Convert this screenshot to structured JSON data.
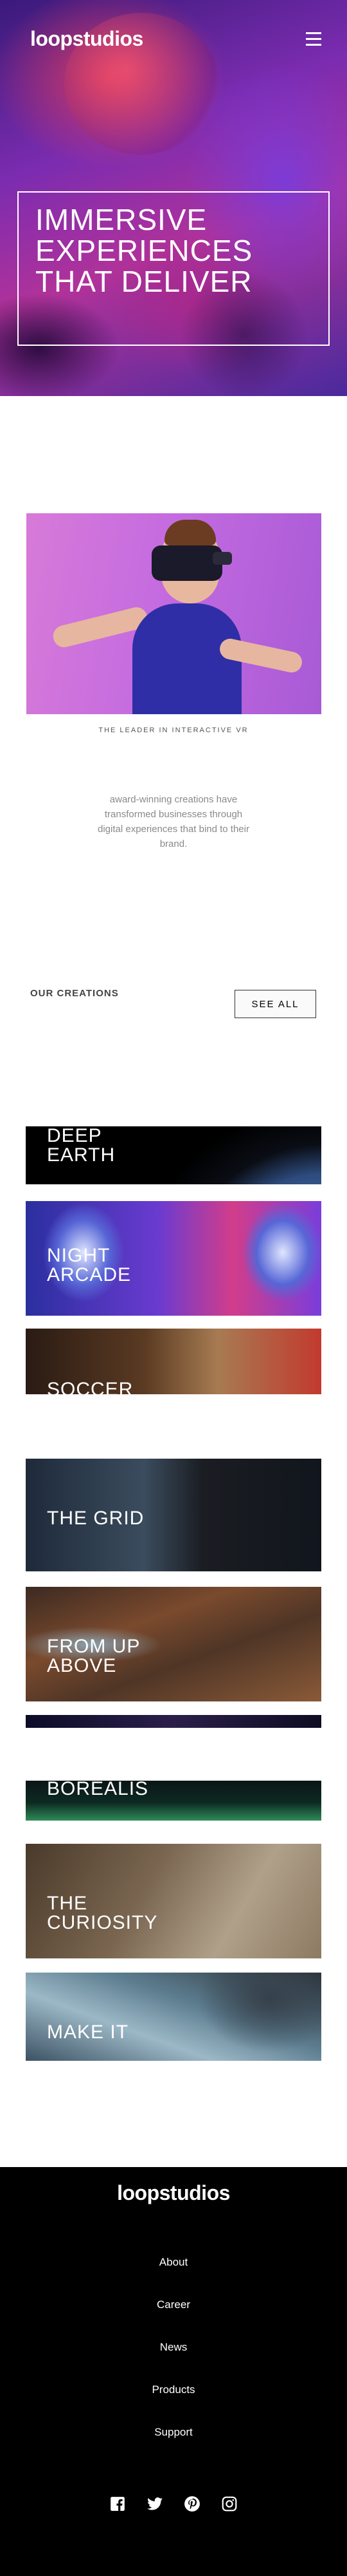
{
  "header": {
    "logo": "loopstudios",
    "menu_icon": "hamburger-icon"
  },
  "hero": {
    "title": "Immersive experiences that deliver"
  },
  "intro": {
    "title": "THE LEADER IN INTERACTIVE VR",
    "text": "award-winning creations have transformed businesses through digital experiences that bind to their brand."
  },
  "creations": {
    "heading": "OUR CREATIONS",
    "see_all": "SEE ALL",
    "items": [
      {
        "title": "Deep earth"
      },
      {
        "title": "Night arcade"
      },
      {
        "title": "Soccer"
      },
      {
        "title": "The grid"
      },
      {
        "title": "From up above"
      },
      {
        "title": "Borealis"
      },
      {
        "title": "The curiosity"
      },
      {
        "title": "Make it"
      }
    ]
  },
  "footer": {
    "logo": "loopstudios",
    "links": [
      "About",
      "Career",
      "News",
      "Products",
      "Support"
    ],
    "social_icons": [
      "facebook-icon",
      "twitter-icon",
      "pinterest-icon",
      "instagram-icon"
    ]
  }
}
